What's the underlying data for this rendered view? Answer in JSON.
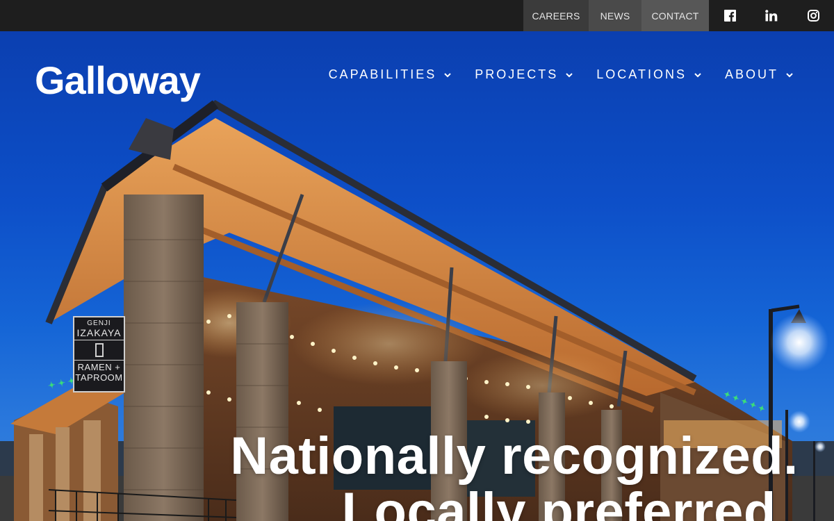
{
  "topbar": {
    "links": [
      "CAREERS",
      "NEWS",
      "CONTACT"
    ],
    "social": [
      "facebook-icon",
      "linkedin-icon",
      "instagram-icon"
    ]
  },
  "brand": {
    "logo_text": "Galloway"
  },
  "nav": {
    "items": [
      "CAPABILITIES",
      "PROJECTS",
      "LOCATIONS",
      "ABOUT"
    ]
  },
  "hero": {
    "headline_line1": "Nationally recognized.",
    "headline_line2": "Locally preferred.",
    "sign": {
      "line1": "GENJI",
      "line2": "IZAKAYA",
      "line3": "RAMEN +",
      "line4": "TAPROOM"
    }
  },
  "colors": {
    "topbar": "#1e1e1e",
    "sky": "#0d4fc8",
    "text": "#ffffff"
  }
}
